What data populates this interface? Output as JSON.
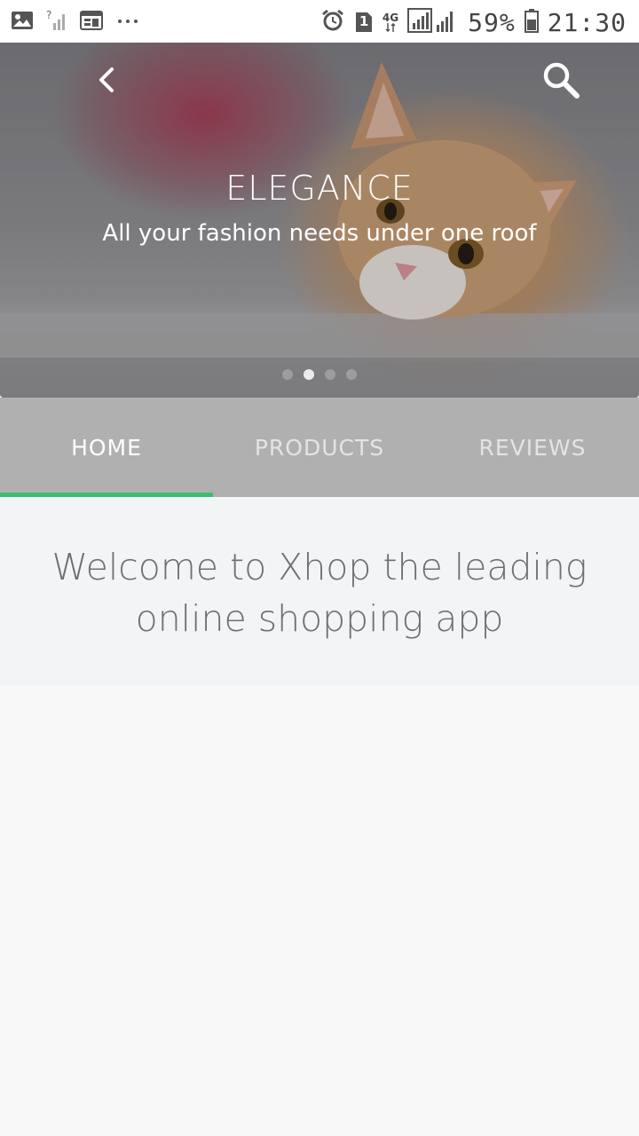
{
  "status_bar": {
    "time": "21:30",
    "battery": "59%",
    "network": "4G",
    "sim_slot": "1",
    "icons": [
      "image-icon",
      "no-signal-icon",
      "calendar-icon",
      "more-dots-icon",
      "alarm-icon",
      "sim-icon",
      "network-4g-icon",
      "signal-icon",
      "battery-icon"
    ]
  },
  "hero": {
    "title": "ELEGANCE",
    "subtitle": "All your fashion needs under one roof",
    "back_icon": "chevron-left-icon",
    "search_icon": "search-icon",
    "carousel_active_index": 1,
    "carousel_count": 4
  },
  "tabs": [
    {
      "label": "HOME",
      "active": true
    },
    {
      "label": "PRODUCTS",
      "active": false
    },
    {
      "label": "REVIEWS",
      "active": false
    }
  ],
  "colors": {
    "tab_bar": "#b0b0b0",
    "tab_indicator": "#3dbd6c",
    "welcome_bg": "#f3f4f6",
    "page_bg": "#f8f8f8"
  },
  "welcome": {
    "line1": "Welcome to Xhop the leading",
    "line2": "online shopping app"
  }
}
